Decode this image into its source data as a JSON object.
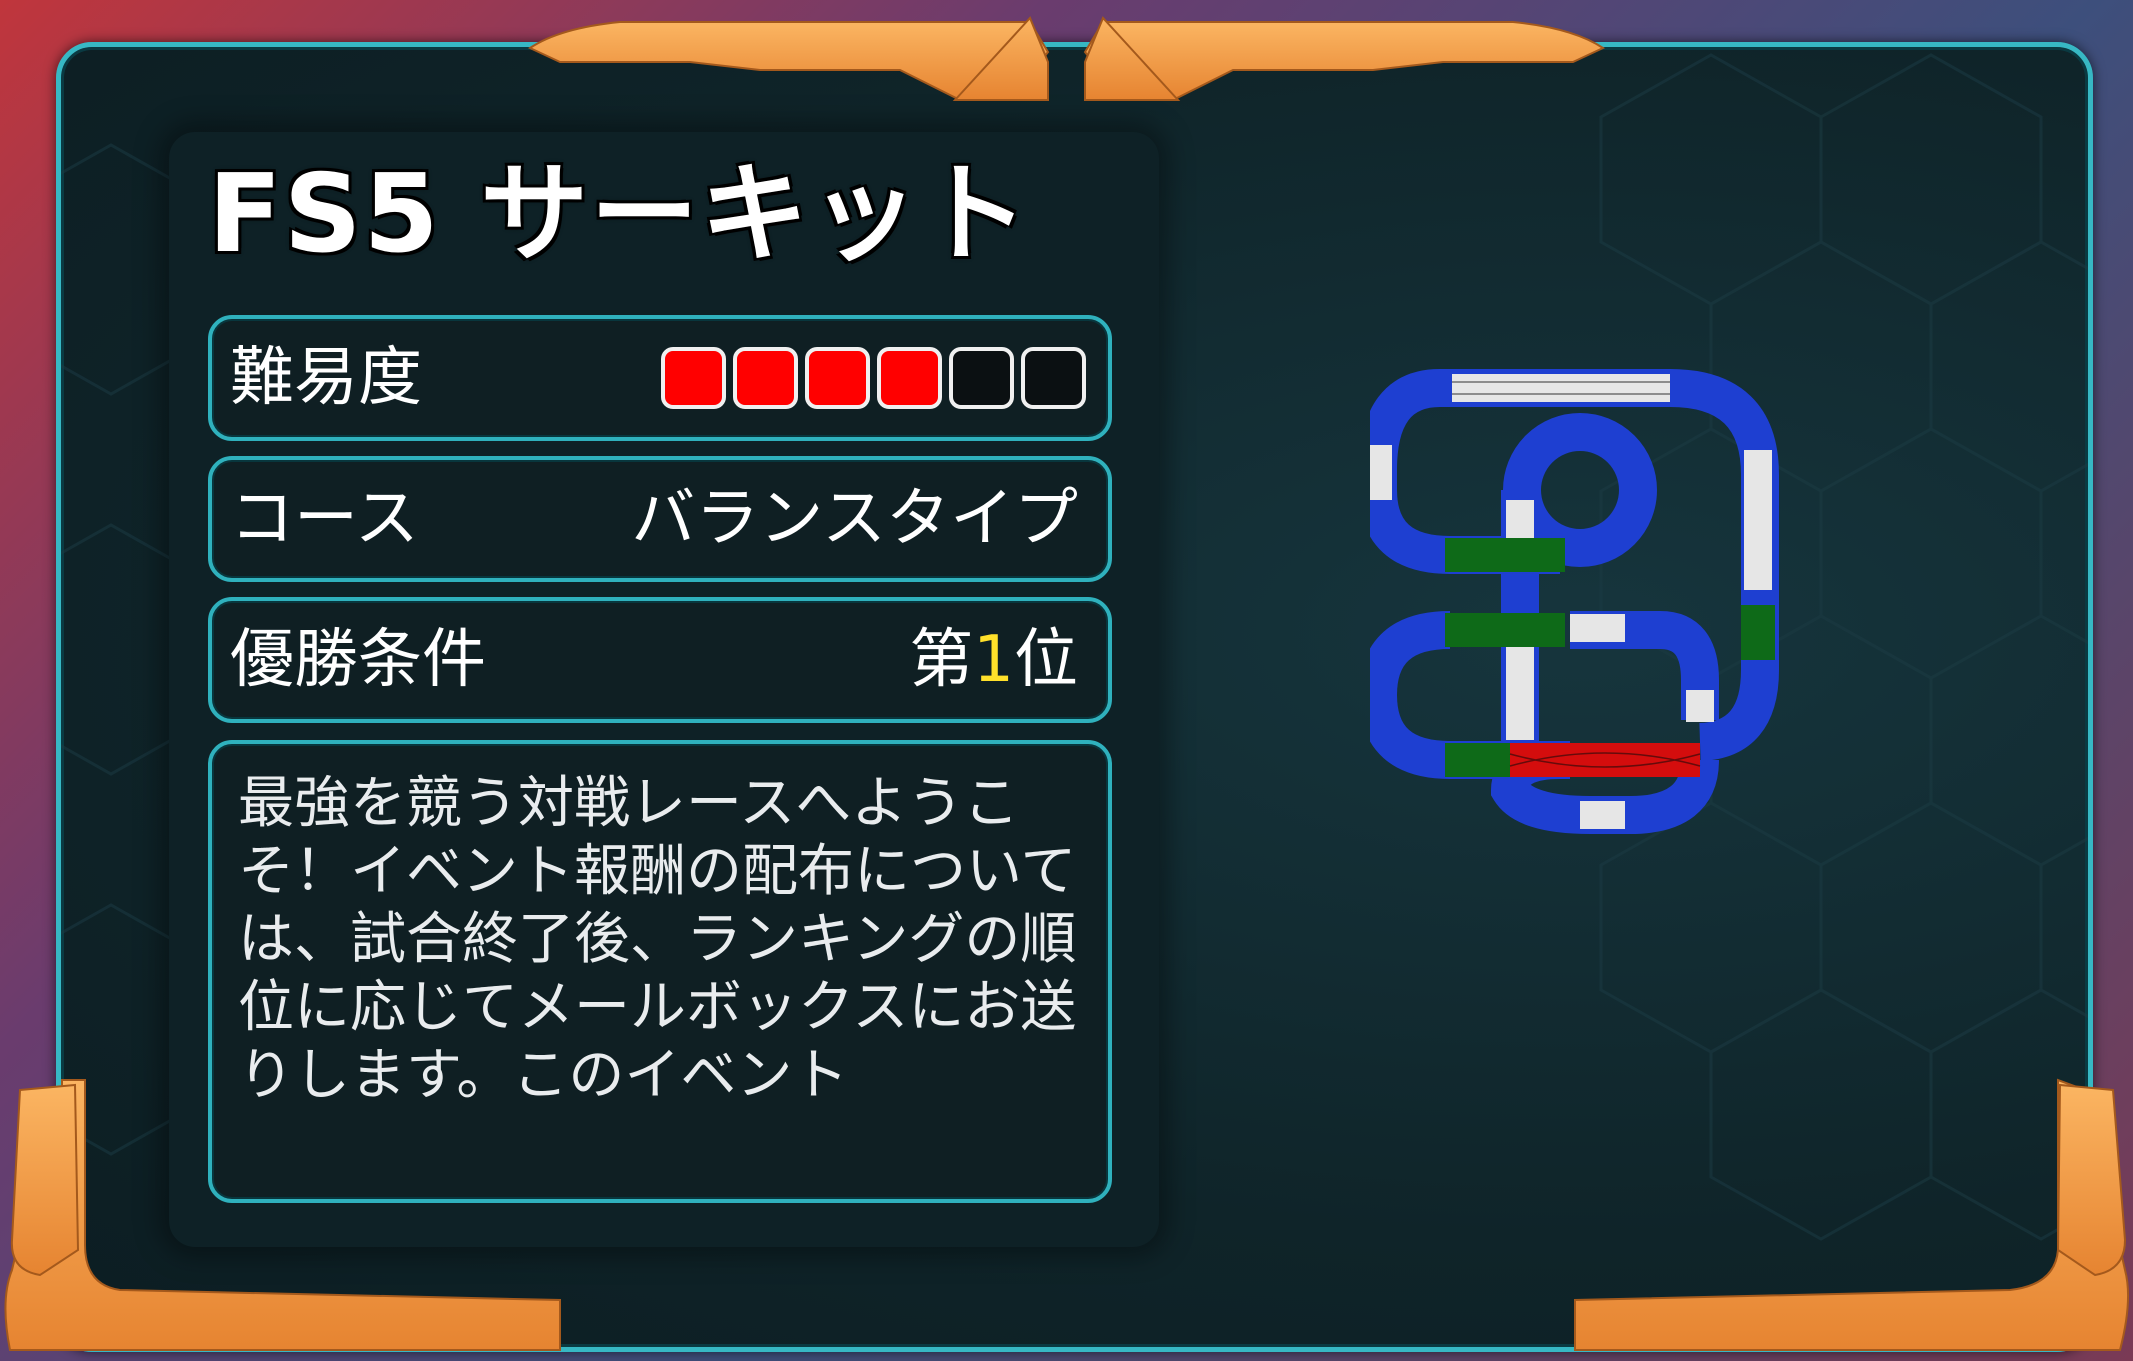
{
  "course": {
    "title": "FS5 サーキット"
  },
  "difficulty": {
    "label": "難易度",
    "filled": 4,
    "total": 6,
    "filled_color": "#ff0000",
    "empty_color": "#0b1012"
  },
  "course_type": {
    "label": "コース",
    "value": "バランスタイプ"
  },
  "victory": {
    "label": "優勝条件",
    "prefix": "第",
    "number": "1",
    "suffix": "位"
  },
  "description": {
    "text": "最強を競う対戦レースへようこそ！イベント報酬の配布については、試合終了後、ランキングの順位に応じてメールボックスにお送りします。このイベント"
  },
  "colors": {
    "frame_border": "#37b8c4",
    "accent_orange": "#f7a04a",
    "track_blue": "#1e3fd1",
    "track_white": "#e6e6e6",
    "track_green": "#0e6a18",
    "track_red": "#d40d0d",
    "highlight_yellow": "#ffe02a"
  },
  "icons": {
    "track_map": "course-layout-icon"
  }
}
